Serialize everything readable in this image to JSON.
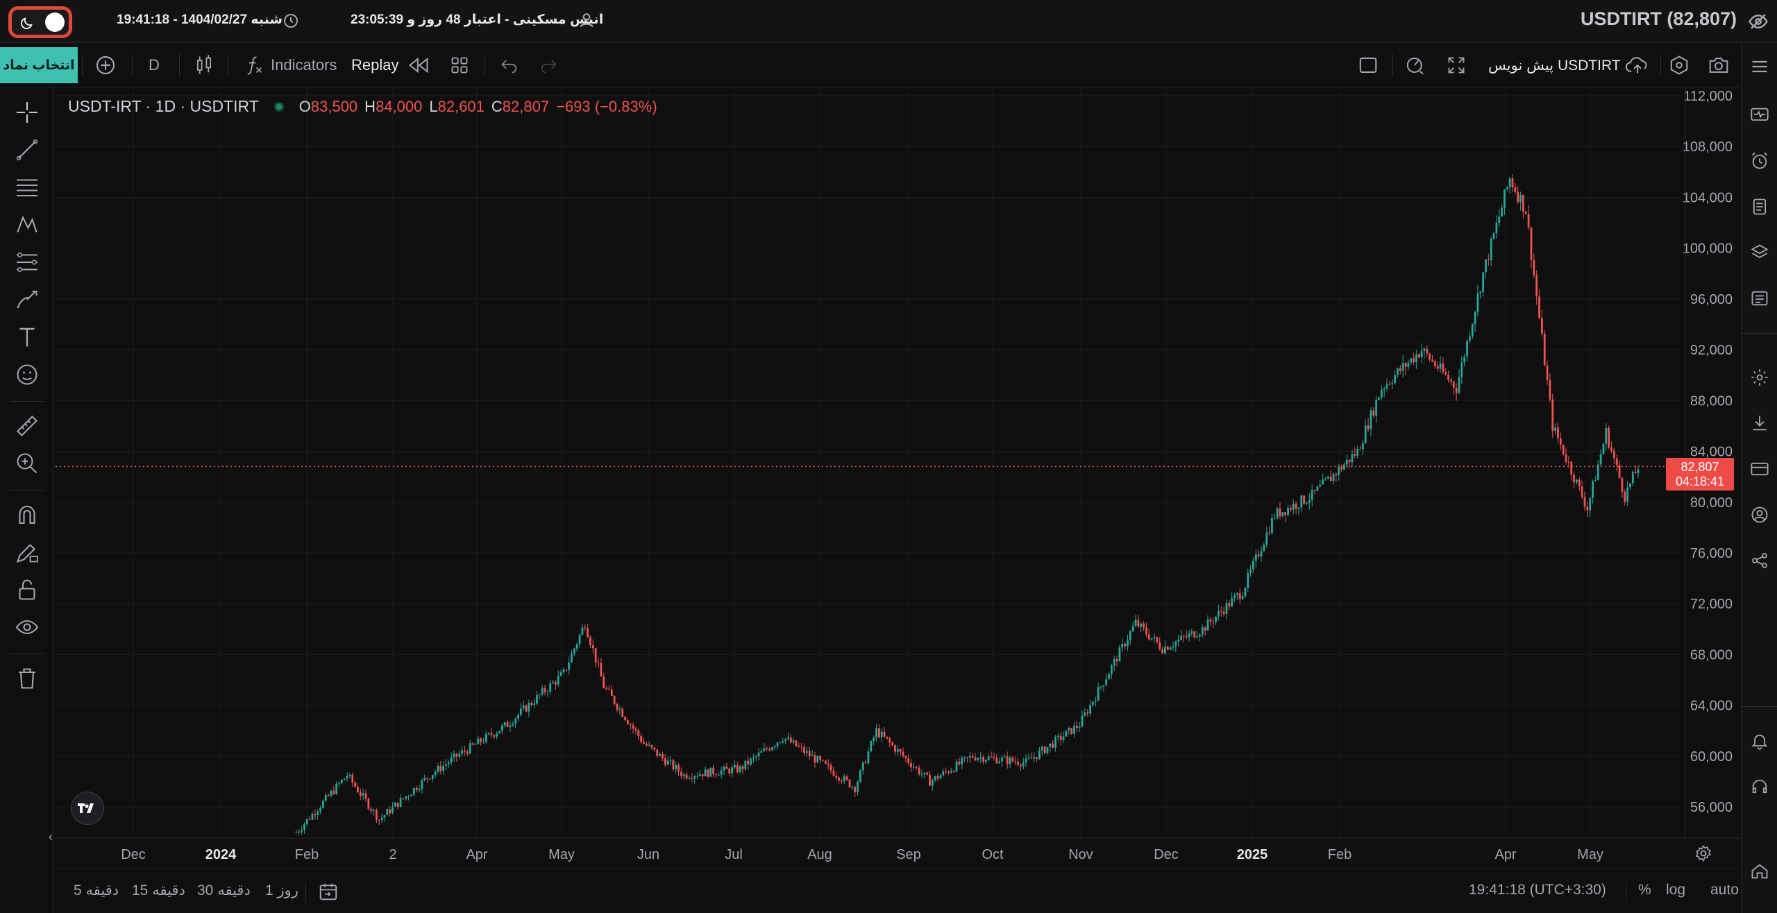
{
  "topbar": {
    "datetime_text": "شنبه 1404/02/27 - 19:41:18",
    "user_text": "انیس مسکینی - اعتبار 48 روز و 23:05:39",
    "symbol_price": "USDTIRT (82,807)"
  },
  "toolbar": {
    "choose_symbol": "انتخاب نماد",
    "interval": "D",
    "indicators": "Indicators",
    "replay": "Replay",
    "draft_label": "USDTIRT پیش نویس"
  },
  "legend": {
    "symbol": "USDT-IRT · 1D · USDTIRT",
    "open_k": "O",
    "open": "83,500",
    "high_k": "H",
    "high": "84,000",
    "low_k": "L",
    "low": "82,601",
    "close_k": "C",
    "close": "82,807",
    "change": "−693 (−0.83%)"
  },
  "price_badge": {
    "price": "82,807",
    "countdown": "04:18:41"
  },
  "bottombar": {
    "ranges": [
      "5 دقیقه",
      "15 دقیقه",
      "30 دقیقه",
      "1 روز"
    ],
    "clock": "19:41:18 (UTC+3:30)",
    "percent": "%",
    "log": "log",
    "auto": "auto"
  },
  "colors": {
    "up": "#26a69a",
    "down": "#ef5350",
    "accent": "#3fc0b0",
    "highlight": "#e2473b"
  },
  "chart_data": {
    "type": "candlestick",
    "symbol": "USDT-IRT",
    "interval": "1D",
    "y_ticks": [
      56000,
      60000,
      64000,
      68000,
      72000,
      76000,
      80000,
      84000,
      88000,
      92000,
      96000,
      100000,
      104000,
      108000,
      112000
    ],
    "y_tick_labels": [
      "56,000",
      "60,000",
      "64,000",
      "68,000",
      "72,000",
      "76,000",
      "80,000",
      "84,000",
      "88,000",
      "92,000",
      "96,000",
      "100,000",
      "104,000",
      "108,000",
      "112,000"
    ],
    "ylim": [
      53000,
      112000
    ],
    "x_labels": [
      "Dec",
      "2024",
      "Feb",
      "2",
      "Apr",
      "May",
      "Jun",
      "Jul",
      "Aug",
      "Sep",
      "Oct",
      "Nov",
      "Dec",
      "2025",
      "Feb",
      "Apr",
      "May"
    ],
    "last_close": 82807,
    "trend_points": [
      {
        "x": "2024-01-01",
        "y": 54000
      },
      {
        "x": "2024-01-20",
        "y": 58500
      },
      {
        "x": "2024-02-01",
        "y": 55000
      },
      {
        "x": "2024-02-20",
        "y": 58500
      },
      {
        "x": "2024-03-01",
        "y": 60000
      },
      {
        "x": "2024-03-20",
        "y": 62500
      },
      {
        "x": "2024-04-10",
        "y": 66500
      },
      {
        "x": "2024-04-18",
        "y": 70500
      },
      {
        "x": "2024-04-25",
        "y": 65500
      },
      {
        "x": "2024-05-10",
        "y": 61000
      },
      {
        "x": "2024-05-25",
        "y": 58500
      },
      {
        "x": "2024-06-15",
        "y": 59000
      },
      {
        "x": "2024-07-01",
        "y": 61500
      },
      {
        "x": "2024-07-15",
        "y": 59500
      },
      {
        "x": "2024-07-28",
        "y": 57500
      },
      {
        "x": "2024-08-05",
        "y": 62000
      },
      {
        "x": "2024-08-25",
        "y": 58000
      },
      {
        "x": "2024-09-10",
        "y": 60000
      },
      {
        "x": "2024-09-30",
        "y": 59500
      },
      {
        "x": "2024-10-20",
        "y": 62500
      },
      {
        "x": "2024-11-01",
        "y": 67000
      },
      {
        "x": "2024-11-10",
        "y": 70500
      },
      {
        "x": "2024-11-20",
        "y": 68500
      },
      {
        "x": "2024-12-05",
        "y": 70000
      },
      {
        "x": "2024-12-20",
        "y": 73000
      },
      {
        "x": "2025-01-01",
        "y": 79000
      },
      {
        "x": "2025-01-15",
        "y": 80500
      },
      {
        "x": "2025-02-01",
        "y": 84000
      },
      {
        "x": "2025-02-10",
        "y": 89000
      },
      {
        "x": "2025-02-25",
        "y": 92000
      },
      {
        "x": "2025-03-10",
        "y": 89000
      },
      {
        "x": "2025-03-20",
        "y": 98000
      },
      {
        "x": "2025-03-30",
        "y": 105500
      },
      {
        "x": "2025-04-05",
        "y": 103000
      },
      {
        "x": "2025-04-15",
        "y": 86000
      },
      {
        "x": "2025-04-28",
        "y": 79500
      },
      {
        "x": "2025-05-05",
        "y": 85500
      },
      {
        "x": "2025-05-12",
        "y": 80500
      },
      {
        "x": "2025-05-17",
        "y": 82807
      }
    ],
    "x_start": "2023-11-01",
    "x_end": "2025-05-17"
  }
}
